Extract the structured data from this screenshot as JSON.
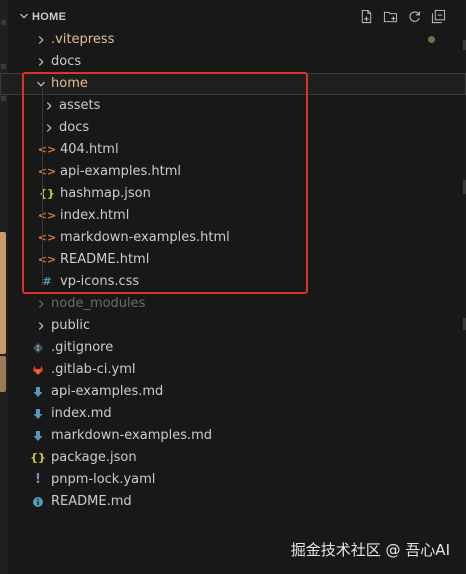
{
  "explorer": {
    "title": "HOME"
  },
  "tree": [
    {
      "label": ".vitepress",
      "type": "folder",
      "depth": 0,
      "expanded": false,
      "color": "yellow",
      "icon": "chevron-right-icon",
      "modified": true
    },
    {
      "label": "docs",
      "type": "folder",
      "depth": 0,
      "expanded": false,
      "icon": "chevron-right-icon"
    },
    {
      "label": "home",
      "type": "folder",
      "depth": 0,
      "expanded": true,
      "color": "yellow",
      "icon": "chevron-down-icon",
      "selected": true
    },
    {
      "label": "assets",
      "type": "folder",
      "depth": 1,
      "expanded": false,
      "icon": "chevron-right-icon"
    },
    {
      "label": "docs",
      "type": "folder",
      "depth": 1,
      "expanded": false,
      "icon": "chevron-right-icon"
    },
    {
      "label": "404.html",
      "type": "file",
      "depth": 1,
      "icon": "html-icon"
    },
    {
      "label": "api-examples.html",
      "type": "file",
      "depth": 1,
      "icon": "html-icon"
    },
    {
      "label": "hashmap.json",
      "type": "file",
      "depth": 1,
      "icon": "json-icon"
    },
    {
      "label": "index.html",
      "type": "file",
      "depth": 1,
      "icon": "html-icon"
    },
    {
      "label": "markdown-examples.html",
      "type": "file",
      "depth": 1,
      "icon": "html-icon"
    },
    {
      "label": "README.html",
      "type": "file",
      "depth": 1,
      "icon": "html-icon"
    },
    {
      "label": "vp-icons.css",
      "type": "file",
      "depth": 1,
      "icon": "css-icon"
    },
    {
      "label": "node_modules",
      "type": "folder",
      "depth": 0,
      "expanded": false,
      "color": "dim",
      "icon": "chevron-right-icon"
    },
    {
      "label": "public",
      "type": "folder",
      "depth": 0,
      "expanded": false,
      "icon": "chevron-right-icon"
    },
    {
      "label": ".gitignore",
      "type": "file",
      "depth": 0,
      "icon": "git-icon"
    },
    {
      "label": ".gitlab-ci.yml",
      "type": "file",
      "depth": 0,
      "icon": "gitlab-icon"
    },
    {
      "label": "api-examples.md",
      "type": "file",
      "depth": 0,
      "icon": "markdown-icon"
    },
    {
      "label": "index.md",
      "type": "file",
      "depth": 0,
      "icon": "markdown-icon"
    },
    {
      "label": "markdown-examples.md",
      "type": "file",
      "depth": 0,
      "icon": "markdown-icon"
    },
    {
      "label": "package.json",
      "type": "file",
      "depth": 0,
      "icon": "json-icon"
    },
    {
      "label": "pnpm-lock.yaml",
      "type": "file",
      "depth": 0,
      "icon": "yaml-icon"
    },
    {
      "label": "README.md",
      "type": "file",
      "depth": 0,
      "icon": "info-icon"
    }
  ],
  "watermark": "掘金技术社区 @ 吾心AI",
  "colors": {
    "background": "#181818",
    "highlight_border": "#e0302a",
    "html": "#e37933",
    "json": "#cbcb41",
    "css": "#519aba",
    "markdown": "#519aba",
    "yaml": "#a074c4",
    "git": "#41535b",
    "gitlab": "#e24329",
    "folder_modified": "#e2c08d"
  }
}
